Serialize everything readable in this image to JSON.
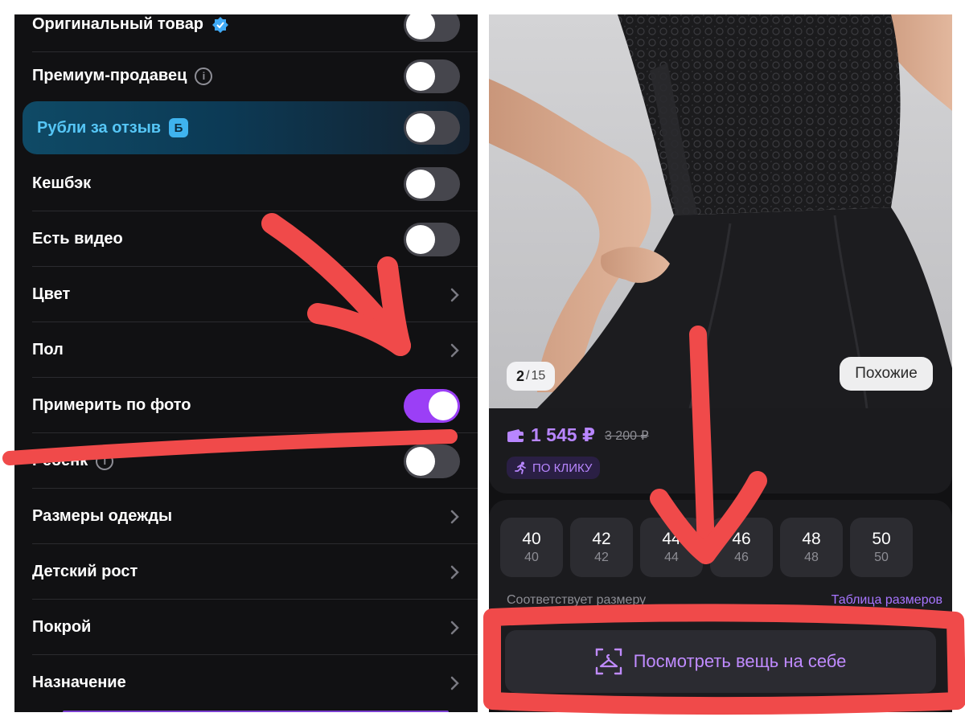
{
  "filters": {
    "rows": [
      {
        "label": "Оригинальный товар",
        "control": "toggle",
        "on": false
      },
      {
        "label": "Премиум-продавец",
        "control": "toggle",
        "on": false
      },
      {
        "label": "Рубли за отзыв",
        "control": "toggle",
        "on": false,
        "badge": "Б"
      },
      {
        "label": "Кешбэк",
        "control": "toggle",
        "on": false
      },
      {
        "label": "Есть видео",
        "control": "toggle",
        "on": false
      },
      {
        "label": "Цвет",
        "control": "chevron"
      },
      {
        "label": "Пол",
        "control": "chevron"
      },
      {
        "label": "Примерить по фото",
        "control": "toggle",
        "on": true
      },
      {
        "label": "Ребенк",
        "control": "toggle",
        "on": false
      },
      {
        "label": "Размеры одежды",
        "control": "chevron"
      },
      {
        "label": "Детский рост",
        "control": "chevron"
      },
      {
        "label": "Покрой",
        "control": "chevron"
      },
      {
        "label": "Назначение",
        "control": "chevron"
      }
    ],
    "info_glyph": "i"
  },
  "product": {
    "photo_counter": {
      "current": "2",
      "total": "15"
    },
    "similar_label": "Похожие",
    "price": "1 545 ₽",
    "old_price": "3 200 ₽",
    "click_badge": "ПО КЛИКУ",
    "sizes": [
      {
        "ru": "40",
        "eu": "40"
      },
      {
        "ru": "42",
        "eu": "42"
      },
      {
        "ru": "44",
        "eu": "44"
      },
      {
        "ru": "46",
        "eu": "46"
      },
      {
        "ru": "48",
        "eu": "48"
      },
      {
        "ru": "50",
        "eu": "50"
      }
    ],
    "size_fit_text": "Соответствует размеру",
    "size_table_link": "Таблица размеров",
    "try_on_label": "Посмотреть вещь на себе"
  },
  "icons": [
    "verified-badge-icon",
    "info-icon",
    "b-coin-icon",
    "toggle-switch",
    "chevron-right-icon",
    "wallet-icon",
    "running-man-icon",
    "hanger-scan-icon"
  ],
  "colors": {
    "accent_purple": "#9b3ff6",
    "price_purple": "#b886ff",
    "annotation_red": "#f04a4a",
    "highlight_blue": "#56c6f6"
  }
}
